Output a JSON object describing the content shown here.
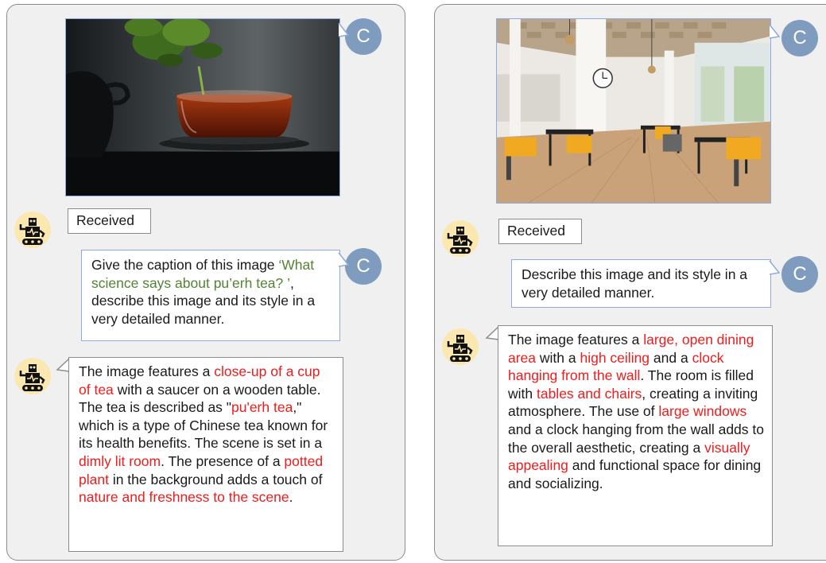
{
  "user_initial": "C",
  "colors": {
    "highlight": "#ee1c1c",
    "quote": "#548235",
    "user_avatar": "#7f9cbf",
    "bot_avatar_bg": "#fbe8b0"
  },
  "icons": {
    "user": "user-avatar-icon",
    "bot": "robot-icon"
  },
  "left": {
    "photo": "close-up of a glass cup of tea on a saucer with a teapot and plant",
    "received_label": "Received",
    "prompt": {
      "p1": "Give the caption of this image ",
      "q": "‘What science says about pu’erh tea? ’",
      "p2": ", describe this image and its style in a very detailed manner."
    },
    "response": {
      "t1": "The image features a ",
      "h1": "close-up of a cup of tea",
      "t2": " with a saucer on a wooden table. The tea is described as \"",
      "h2": "pu'erh tea",
      "t3": ",\" which is a type of Chinese tea known for its health benefits. The scene is set in a ",
      "h3": "dimly lit room",
      "t4": ". The presence of a ",
      "h4": "potted plant",
      "t5": " in the background adds a touch of ",
      "h5": "nature and freshness to the scene",
      "t6": "."
    }
  },
  "right": {
    "photo": "bright open dining hall with tables, yellow chairs, clock and large windows",
    "received_label": "Received",
    "prompt": "Describe this image and its style in a very detailed manner.",
    "response": {
      "t1": "The image features a ",
      "h1": "large, open dining area",
      "t2": " with a ",
      "h2": "high ceiling",
      "t3": " and a ",
      "h3": "clock hanging from the wall",
      "t4": ". The room is filled with ",
      "h4": "tables and chairs",
      "t5": ", creating a inviting atmosphere. The use of ",
      "h5": "large windows",
      "t6": " and a clock hanging from the wall adds to the overall aesthetic, creating a ",
      "h6": "visually appealing",
      "t7": " and functional space for dining and socializing."
    }
  }
}
